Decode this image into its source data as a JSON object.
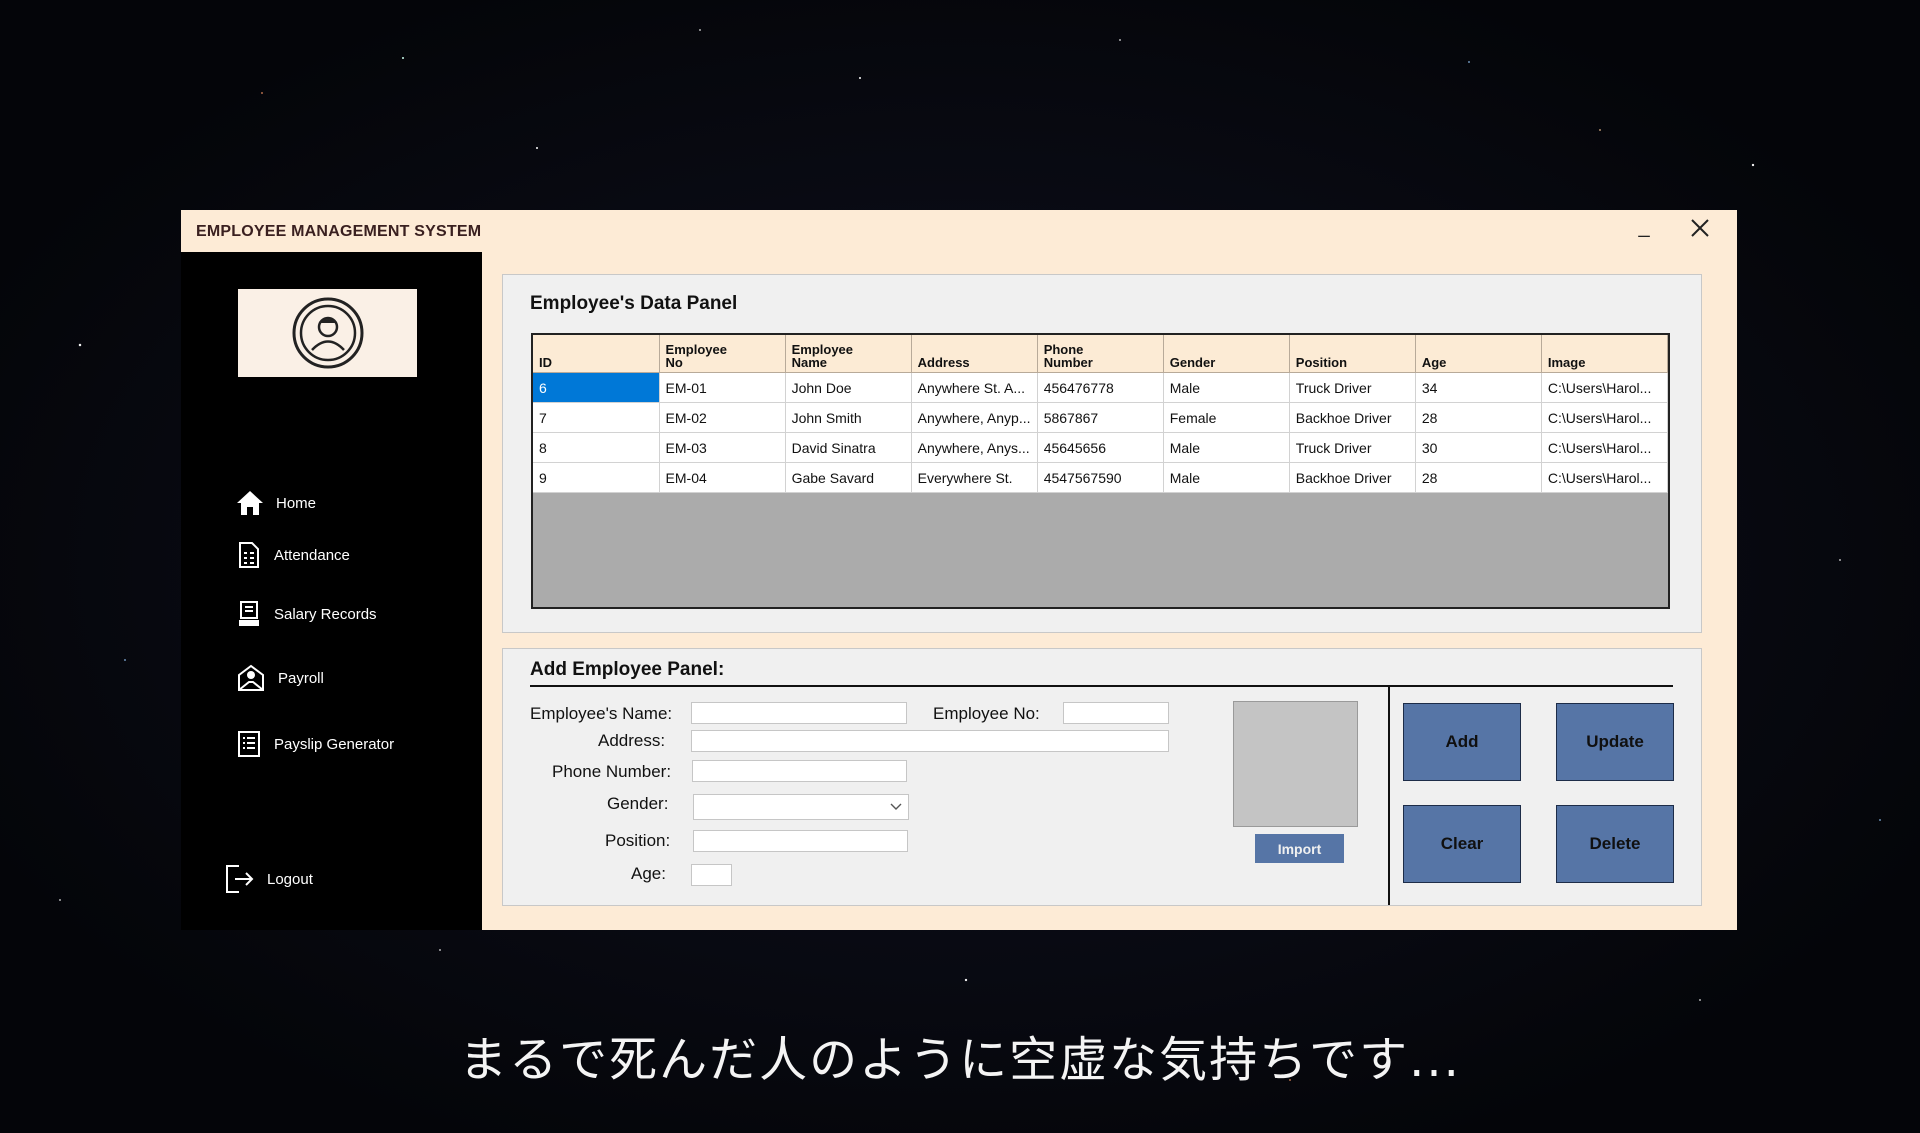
{
  "window": {
    "title": "EMPLOYEE MANAGEMENT SYSTEM"
  },
  "sidebar": {
    "items": [
      {
        "label": "Home",
        "icon": "home-icon"
      },
      {
        "label": "Attendance",
        "icon": "attendance-icon"
      },
      {
        "label": "Salary Records",
        "icon": "salary-records-icon"
      },
      {
        "label": "Payroll",
        "icon": "payroll-icon"
      },
      {
        "label": "Payslip Generator",
        "icon": "payslip-icon"
      }
    ],
    "logout": {
      "label": "Logout",
      "icon": "logout-icon"
    }
  },
  "data_panel": {
    "title": "Employee's Data Panel",
    "columns": [
      {
        "line1": "ID",
        "line2": ""
      },
      {
        "line1": "Employee",
        "line2": "No"
      },
      {
        "line1": "Employee",
        "line2": "Name"
      },
      {
        "line1": "Address",
        "line2": ""
      },
      {
        "line1": "Phone",
        "line2": "Number"
      },
      {
        "line1": "Gender",
        "line2": ""
      },
      {
        "line1": "Position",
        "line2": ""
      },
      {
        "line1": "Age",
        "line2": ""
      },
      {
        "line1": "Image",
        "line2": ""
      }
    ],
    "rows": [
      [
        "6",
        "EM-01",
        "John Doe",
        "Anywhere St. A...",
        "456476778",
        "Male",
        "Truck Driver",
        "34",
        "C:\\Users\\Harol..."
      ],
      [
        "7",
        "EM-02",
        "John Smith",
        "Anywhere, Anyp...",
        "5867867",
        "Female",
        "Backhoe Driver",
        "28",
        "C:\\Users\\Harol..."
      ],
      [
        "8",
        "EM-03",
        "David Sinatra",
        "Anywhere, Anys...",
        "45645656",
        "Male",
        "Truck Driver",
        "30",
        "C:\\Users\\Harol..."
      ],
      [
        "9",
        "EM-04",
        "Gabe Savard",
        "Everywhere St.",
        "4547567590",
        "Male",
        "Backhoe Driver",
        "28",
        "C:\\Users\\Harol..."
      ]
    ],
    "selected_cell": "6"
  },
  "add_panel": {
    "title": "Add Employee Panel:",
    "name_label": "Employee's Name:",
    "name_value": "",
    "empno_label": "Employee No:",
    "empno_value": "",
    "address_label": "Address:",
    "address_value": "",
    "phone_label": "Phone Number:",
    "phone_value": "",
    "gender_label": "Gender:",
    "gender_value": "",
    "position_label": "Position:",
    "position_value": "",
    "age_label": "Age:",
    "age_value": "",
    "import_label": "Import",
    "buttons": {
      "add": "Add",
      "update": "Update",
      "clear": "Clear",
      "delete": "Delete"
    }
  },
  "colors": {
    "window_bg": "#fdebd6",
    "sidebar_bg": "#000000",
    "button_blue": "#5675a6",
    "selection": "#0078d7"
  },
  "subtitle": "まるで死んだ人のように空虚な気持ちです..."
}
